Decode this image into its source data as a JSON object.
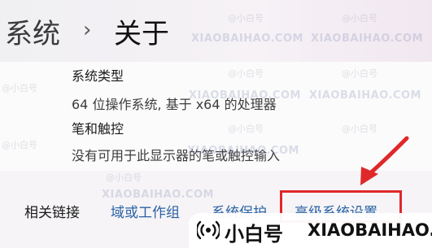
{
  "breadcrumb": {
    "root": "系统",
    "separator": "›",
    "current": "关于"
  },
  "specs": [
    {
      "label": "系统类型",
      "value": "64 位操作系统, 基于 x64 的处理器"
    },
    {
      "label": "笔和触控",
      "value": "没有可用于此显示器的笔或触控输入"
    }
  ],
  "related_links": {
    "label": "相关链接",
    "links": [
      "域或工作组",
      "系统保护",
      "高级系统设置"
    ]
  },
  "watermark": {
    "cn": "@小白号",
    "en": "XIAOBAIHAO.COM"
  },
  "badge": {
    "cn": "小白号",
    "en": "XIAOBAIHAO.COM",
    "icon": "radio-waves-icon"
  },
  "colors": {
    "link": "#2a62a6",
    "highlight": "#e0282b"
  }
}
